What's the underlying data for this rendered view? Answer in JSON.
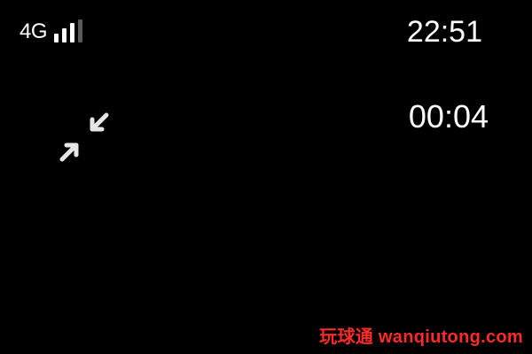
{
  "status_bar": {
    "network": "4G",
    "signal_icon": "cellular-signal-icon",
    "signal_bars_filled": 3,
    "signal_bars_total": 4,
    "time": "22:51"
  },
  "call": {
    "elapsed": "00:04",
    "minimize_icon": "minimize-arrows-icon"
  },
  "watermark": {
    "text": "玩球通 wanqiutong.com",
    "color": "#ff2a2a"
  }
}
